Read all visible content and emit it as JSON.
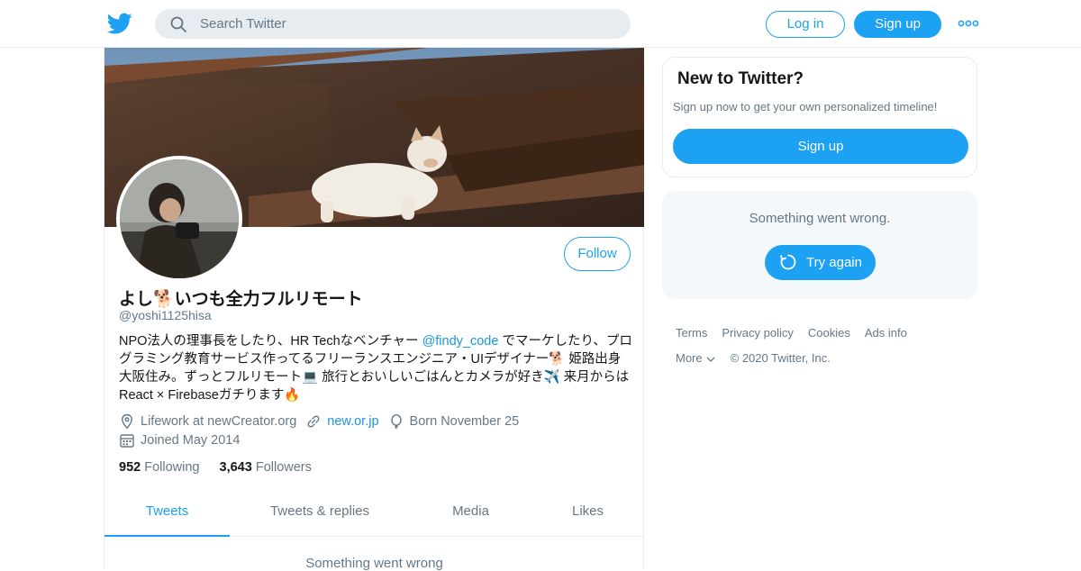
{
  "header": {
    "logo_icon": "twitter-bird-icon",
    "search_placeholder": "Search Twitter",
    "login_label": "Log in",
    "signup_label": "Sign up",
    "more_icon": "more-dots-icon"
  },
  "profile": {
    "name": "よし🐕いつも全力フルリモート",
    "handle": "@yoshi1125hisa",
    "follow_label": "Follow",
    "bio_part1": "NPO法人の理事長をしたり、HR Techなベンチャー ",
    "bio_mention": "@findy_code",
    "bio_part2": " でマーケしたり、プログラミング教育サービス作ってるフリーランスエンジニア・UIデザイナー🐕 姫路出身大阪住み。ずっとフルリモート💻 旅行とおいしいごはんとカメラが好き✈️ 来月からはReact × Firebaseガチります🔥",
    "location": "Lifework at newCreator.org",
    "website": "new.or.jp",
    "birthday": "Born November 25",
    "joined": "Joined May 2014",
    "following_count": "952",
    "following_label": "Following",
    "followers_count": "3,643",
    "followers_label": "Followers",
    "tabs": [
      {
        "label": "Tweets",
        "active": true
      },
      {
        "label": "Tweets & replies",
        "active": false
      },
      {
        "label": "Media",
        "active": false
      },
      {
        "label": "Likes",
        "active": false
      }
    ],
    "feed_error": "Something went wrong"
  },
  "sidebar": {
    "new_title": "New to Twitter?",
    "new_text": "Sign up now to get your own personalized timeline!",
    "signup_label": "Sign up",
    "error_text": "Something went wrong.",
    "try_again_label": "Try again"
  },
  "footer": {
    "terms": "Terms",
    "privacy": "Privacy policy",
    "cookies": "Cookies",
    "ads": "Ads info",
    "more": "More",
    "copyright": "© 2020 Twitter, Inc."
  },
  "colors": {
    "accent": "#1da1f2",
    "secondary_text": "#657786",
    "border": "#e6ecf0",
    "panel_bg": "#f5f8fa"
  }
}
